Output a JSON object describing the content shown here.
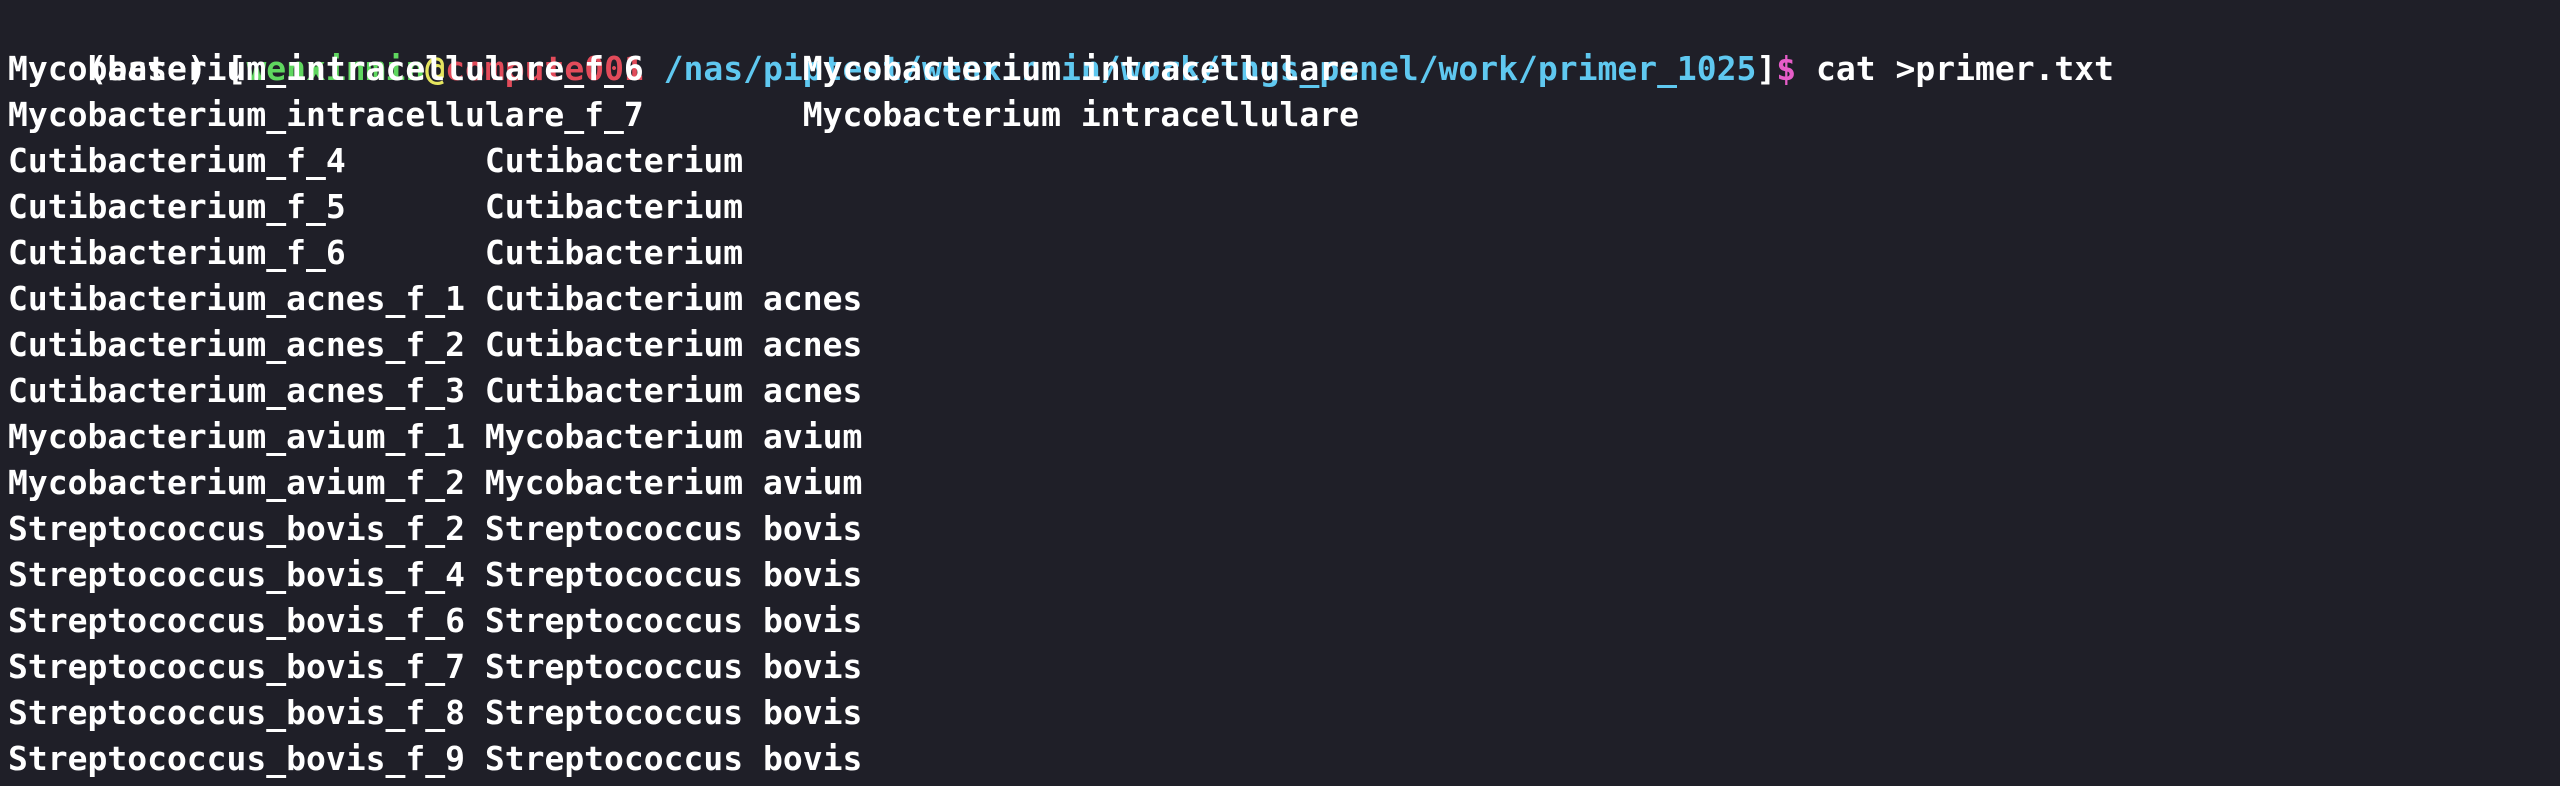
{
  "prompt": {
    "env": "(base) [",
    "user": "wenxinmin",
    "at": "@",
    "host": "compute001",
    "path": " /nas/piptest/wenxinmin/work/tngs_panel/work/primer_1025",
    "close": "]",
    "dollar": "$",
    "command": " cat >primer.txt"
  },
  "colors": {
    "background": "#1f1f28",
    "user": "#5fd75f",
    "at": "#e5e55f",
    "host": "#e24b5a",
    "path": "#5fc8f0",
    "dollar": "#e65dc8",
    "text": "#ffffff"
  },
  "lines": [
    {
      "id": "Mycobacterium_intracellulare_f_6",
      "gap": "        ",
      "name": "Mycobacterium intracellulare"
    },
    {
      "id": "Mycobacterium_intracellulare_f_7",
      "gap": "        ",
      "name": "Mycobacterium intracellulare"
    },
    {
      "id": "Cutibacterium_f_4",
      "gap": "       ",
      "name": "Cutibacterium"
    },
    {
      "id": "Cutibacterium_f_5",
      "gap": "       ",
      "name": "Cutibacterium"
    },
    {
      "id": "Cutibacterium_f_6",
      "gap": "       ",
      "name": "Cutibacterium"
    },
    {
      "id": "Cutibacterium_acnes_f_1",
      "gap": " ",
      "name": "Cutibacterium acnes"
    },
    {
      "id": "Cutibacterium_acnes_f_2",
      "gap": " ",
      "name": "Cutibacterium acnes"
    },
    {
      "id": "Cutibacterium_acnes_f_3",
      "gap": " ",
      "name": "Cutibacterium acnes"
    },
    {
      "id": "Mycobacterium_avium_f_1",
      "gap": " ",
      "name": "Mycobacterium avium"
    },
    {
      "id": "Mycobacterium_avium_f_2",
      "gap": " ",
      "name": "Mycobacterium avium"
    },
    {
      "id": "Streptococcus_bovis_f_2",
      "gap": " ",
      "name": "Streptococcus bovis"
    },
    {
      "id": "Streptococcus_bovis_f_4",
      "gap": " ",
      "name": "Streptococcus bovis"
    },
    {
      "id": "Streptococcus_bovis_f_6",
      "gap": " ",
      "name": "Streptococcus bovis"
    },
    {
      "id": "Streptococcus_bovis_f_7",
      "gap": " ",
      "name": "Streptococcus bovis"
    },
    {
      "id": "Streptococcus_bovis_f_8",
      "gap": " ",
      "name": "Streptococcus bovis"
    },
    {
      "id": "Streptococcus_bovis_f_9",
      "gap": " ",
      "name": "Streptococcus bovis"
    }
  ]
}
